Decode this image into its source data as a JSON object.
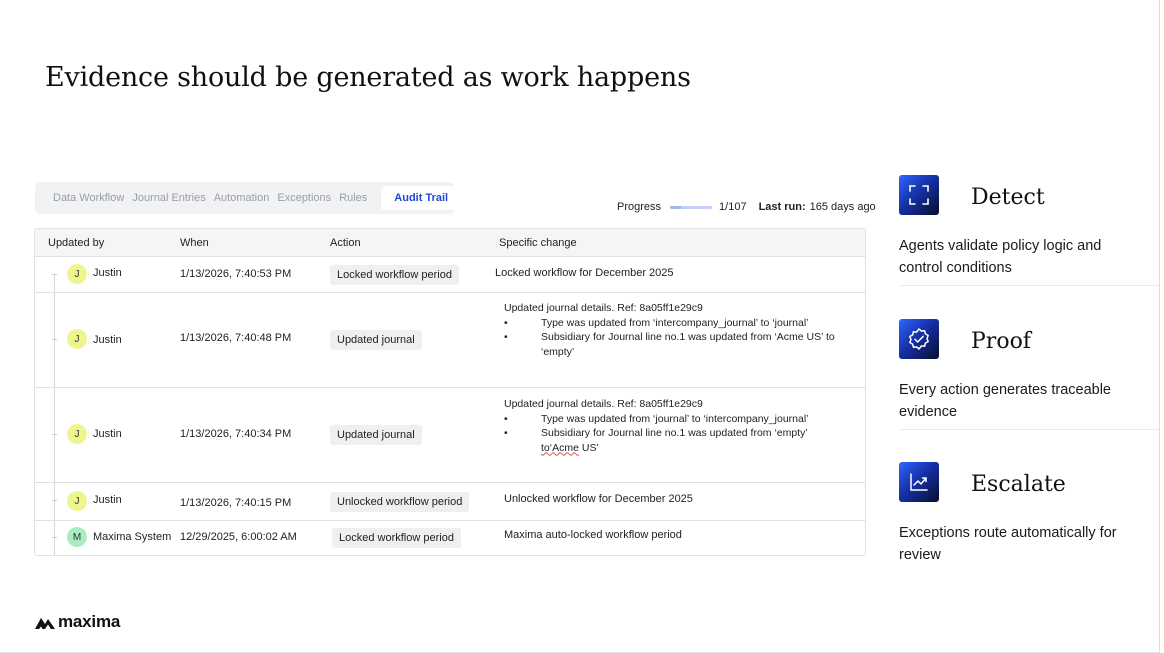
{
  "page": {
    "title": "Evidence should be generated as work happens"
  },
  "tabs": [
    {
      "label": "Data Workflow",
      "active": false
    },
    {
      "label": "Journal Entries",
      "active": false
    },
    {
      "label": "Automation",
      "active": false
    },
    {
      "label": "Exceptions",
      "active": false
    },
    {
      "label": "Rules",
      "active": false
    },
    {
      "label": "Audit Trail",
      "active": true
    }
  ],
  "progress": {
    "label": "Progress",
    "count": "1/107",
    "fraction": 0.25,
    "last_run_label": "Last run:",
    "last_run_value": "165 days ago"
  },
  "table": {
    "headers": {
      "updated_by": "Updated by",
      "when": "When",
      "action": "Action",
      "specific_change": "Specific change"
    },
    "rows": [
      {
        "initial": "J",
        "name": "Justin",
        "when": "1/13/2026, 7:40:53 PM",
        "action": "Locked workflow period",
        "change_title": "Locked workflow for December 2025"
      },
      {
        "initial": "J",
        "name": "Justin",
        "when": "1/13/2026, 7:40:48 PM",
        "action": "Updated journal",
        "change_title": "Updated journal details. Ref: 8a05ff1e29c9",
        "bullets": [
          "Type was updated from ‘intercompany_journal’ to ‘journal’",
          "Subsidiary for Journal line no.1 was updated from ‘Acme US’ to ‘empty’"
        ]
      },
      {
        "initial": "J",
        "name": "Justin",
        "when": "1/13/2026, 7:40:34 PM",
        "action": "Updated journal",
        "change_title": "Updated journal details. Ref: 8a05ff1e29c9",
        "bullets": [
          "Type was updated from ‘journal’ to ‘intercompany_journal’"
        ],
        "bullet2_prefix": "Subsidiary for Journal line no.1 was updated from ‘empty’ ",
        "bullet2_squiggle": "to‘Acme",
        "bullet2_suffix": " US’"
      },
      {
        "initial": "J",
        "name": "Justin",
        "when": "1/13/2026, 7:40:15 PM",
        "action": "Unlocked workflow period",
        "change_title": "Unlocked workflow for December 2025"
      },
      {
        "initial": "M",
        "name": "Maxima System",
        "when": "12/29/2025, 6:00:02 AM",
        "action": "Locked workflow period",
        "change_title": "Maxima auto-locked workflow period"
      }
    ]
  },
  "features": [
    {
      "icon": "focus-frame-icon",
      "title": "Detect",
      "desc": "Agents validate policy logic and control conditions"
    },
    {
      "icon": "verified-badge-icon",
      "title": "Proof",
      "desc": "Every action generates traceable evidence"
    },
    {
      "icon": "trend-chart-icon",
      "title": "Escalate",
      "desc": "Exceptions route automatically for review"
    }
  ],
  "logo": {
    "text": "maxima",
    "icon": "maxima-mountain-icon"
  },
  "colors": {
    "accent": "#2147d6",
    "avatar_user": "#eef58f",
    "avatar_system": "#a9ecc0",
    "icon_gradient_start": "#2f66ff",
    "icon_gradient_end": "#070d2c"
  }
}
